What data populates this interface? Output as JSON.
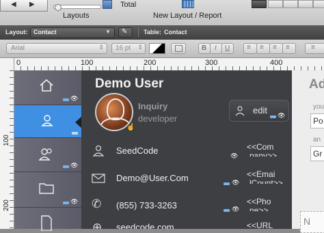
{
  "toolbar": {
    "layouts_label": "Layouts",
    "total_label": "Total",
    "new_layout_label": "New Layout / Report"
  },
  "layout_bar": {
    "layout_label": "Layout:",
    "layout_value": "Contact",
    "table_label": "Table:",
    "table_value": "Contact"
  },
  "format_bar": {
    "font": "Arial",
    "size": "16 pt",
    "bold": "B",
    "italic": "I",
    "underline": "U"
  },
  "ruler": {
    "unit": "pt",
    "h_ticks": [
      "0",
      "100",
      "200",
      "300",
      "400"
    ],
    "v_ticks": [
      "100",
      "200"
    ]
  },
  "header": {
    "name": "Demo User",
    "subtitle1": "Inquiry",
    "subtitle2": "developer",
    "edit_label": "edit"
  },
  "rows": [
    {
      "text": "SeedCode",
      "merge": "<<Com",
      "merge2": "pany>>"
    },
    {
      "text": "Demo@User.Com",
      "merge": "<<Emai",
      "merge2": "lCount>>"
    },
    {
      "text": "(855) 733-3263",
      "merge": "<<Pho",
      "merge2": "ne>>"
    },
    {
      "text": "seedcode.com",
      "merge": "<<URL"
    }
  ],
  "right_pane": {
    "title": "Ad",
    "field1_label": "you",
    "field1_value": "Po",
    "field2_label": "an",
    "field2_value": "Gr",
    "bottom_label": "N"
  }
}
